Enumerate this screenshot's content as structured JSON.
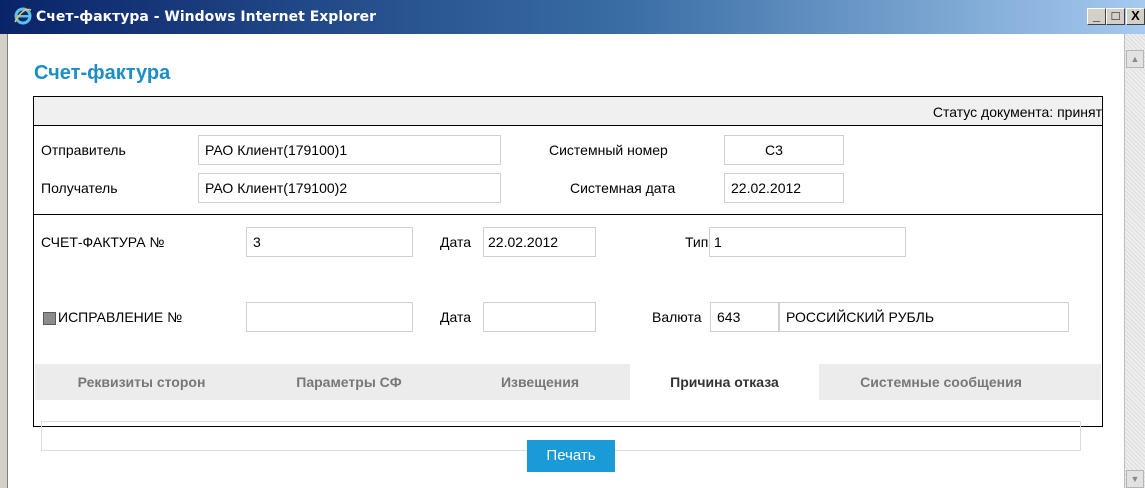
{
  "window": {
    "title": "Счет-фактура - Windows Internet Explorer",
    "controls": {
      "minimize": "_",
      "maximize": "□",
      "close": "X"
    }
  },
  "page": {
    "title": "Счет-фактура"
  },
  "status": {
    "text": "Статус документа: принят"
  },
  "sender": {
    "label": "Отправитель",
    "value": "РАО Клиент(179100)1"
  },
  "recipient": {
    "label": "Получатель",
    "value": "РАО Клиент(179100)2"
  },
  "system_number": {
    "label": "Системный номер",
    "value": "С3"
  },
  "system_date": {
    "label": "Системная дата",
    "value": "22.02.2012"
  },
  "invoice": {
    "number_label": "СЧЕТ-ФАКТУРА №",
    "number_value": "3",
    "date_label": "Дата",
    "date_value": "22.02.2012",
    "type_label": "Тип",
    "type_value": "1"
  },
  "correction": {
    "checked": false,
    "label": "ИСПРАВЛЕНИЕ №",
    "number_value": "",
    "date_label": "Дата",
    "date_value": ""
  },
  "currency": {
    "label": "Валюта",
    "code": "643",
    "name": "РОССИЙСКИЙ РУБЛЬ"
  },
  "tabs": [
    {
      "label": "Реквизиты сторон",
      "active": false
    },
    {
      "label": "Параметры СФ",
      "active": false
    },
    {
      "label": "Извещения",
      "active": false
    },
    {
      "label": "Причина отказа",
      "active": true
    },
    {
      "label": "Системные сообщения",
      "active": false
    }
  ],
  "print_button": {
    "label": "Печать"
  },
  "colors": {
    "title_accent": "#1a8fc7",
    "button": "#1a9bd7",
    "titlebar": "#0a246a"
  }
}
